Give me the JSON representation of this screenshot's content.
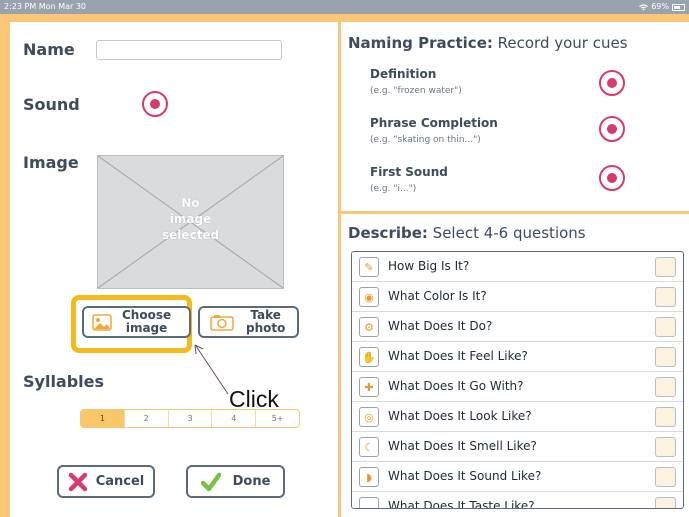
{
  "status": {
    "time": "2:23 PM  Mon Mar 30",
    "battery": "69%",
    "battery_level": 0.69
  },
  "form": {
    "name_label": "Name",
    "name_value": "",
    "sound_label": "Sound",
    "image_label": "Image",
    "no_image_line1": "No",
    "no_image_line2": "image",
    "no_image_line3": "selected",
    "choose_line1": "Choose",
    "choose_line2": "image",
    "take_line1": "Take",
    "take_line2": "photo",
    "syllables_label": "Syllables",
    "syllables": [
      "1",
      "2",
      "3",
      "4",
      "5+"
    ],
    "syllables_selected": "1",
    "cancel_label": "Cancel",
    "done_label": "Done"
  },
  "annotation": {
    "click_text": "Click"
  },
  "naming": {
    "title_bold": "Naming Practice:",
    "title_rest": " Record your cues",
    "cues": [
      {
        "label": "Definition",
        "example": "(e.g. \"frozen water\")"
      },
      {
        "label": "Phrase Completion",
        "example": "(e.g. \"skating on thin...\")"
      },
      {
        "label": "First Sound",
        "example": "(e.g. \"i...\")"
      }
    ]
  },
  "describe": {
    "title_bold": "Describe:",
    "title_rest": " Select 4-6 questions",
    "questions": [
      {
        "text": "How Big Is It?",
        "icon": "ruler-icon",
        "glyph": "✎"
      },
      {
        "text": "What Color Is It?",
        "icon": "palette-icon",
        "glyph": "◉"
      },
      {
        "text": "What Does It Do?",
        "icon": "gears-icon",
        "glyph": "⚙"
      },
      {
        "text": "What Does It Feel Like?",
        "icon": "hand-icon",
        "glyph": "✋"
      },
      {
        "text": "What Does It Go With?",
        "icon": "puzzle-icon",
        "glyph": "✚"
      },
      {
        "text": "What Does It Look Like?",
        "icon": "eye-icon",
        "glyph": "◎"
      },
      {
        "text": "What Does It Smell Like?",
        "icon": "nose-icon",
        "glyph": "☾"
      },
      {
        "text": "What Does It Sound Like?",
        "icon": "ear-icon",
        "glyph": "◗"
      },
      {
        "text": "What Does It Taste Like?",
        "icon": "mouth-icon",
        "glyph": "◡"
      }
    ]
  },
  "colors": {
    "accent": "#f9c777",
    "record": "#d83a6b",
    "highlight": "#f4b91a",
    "cancel_x": "#d83a6b",
    "done_check": "#7ac142"
  }
}
